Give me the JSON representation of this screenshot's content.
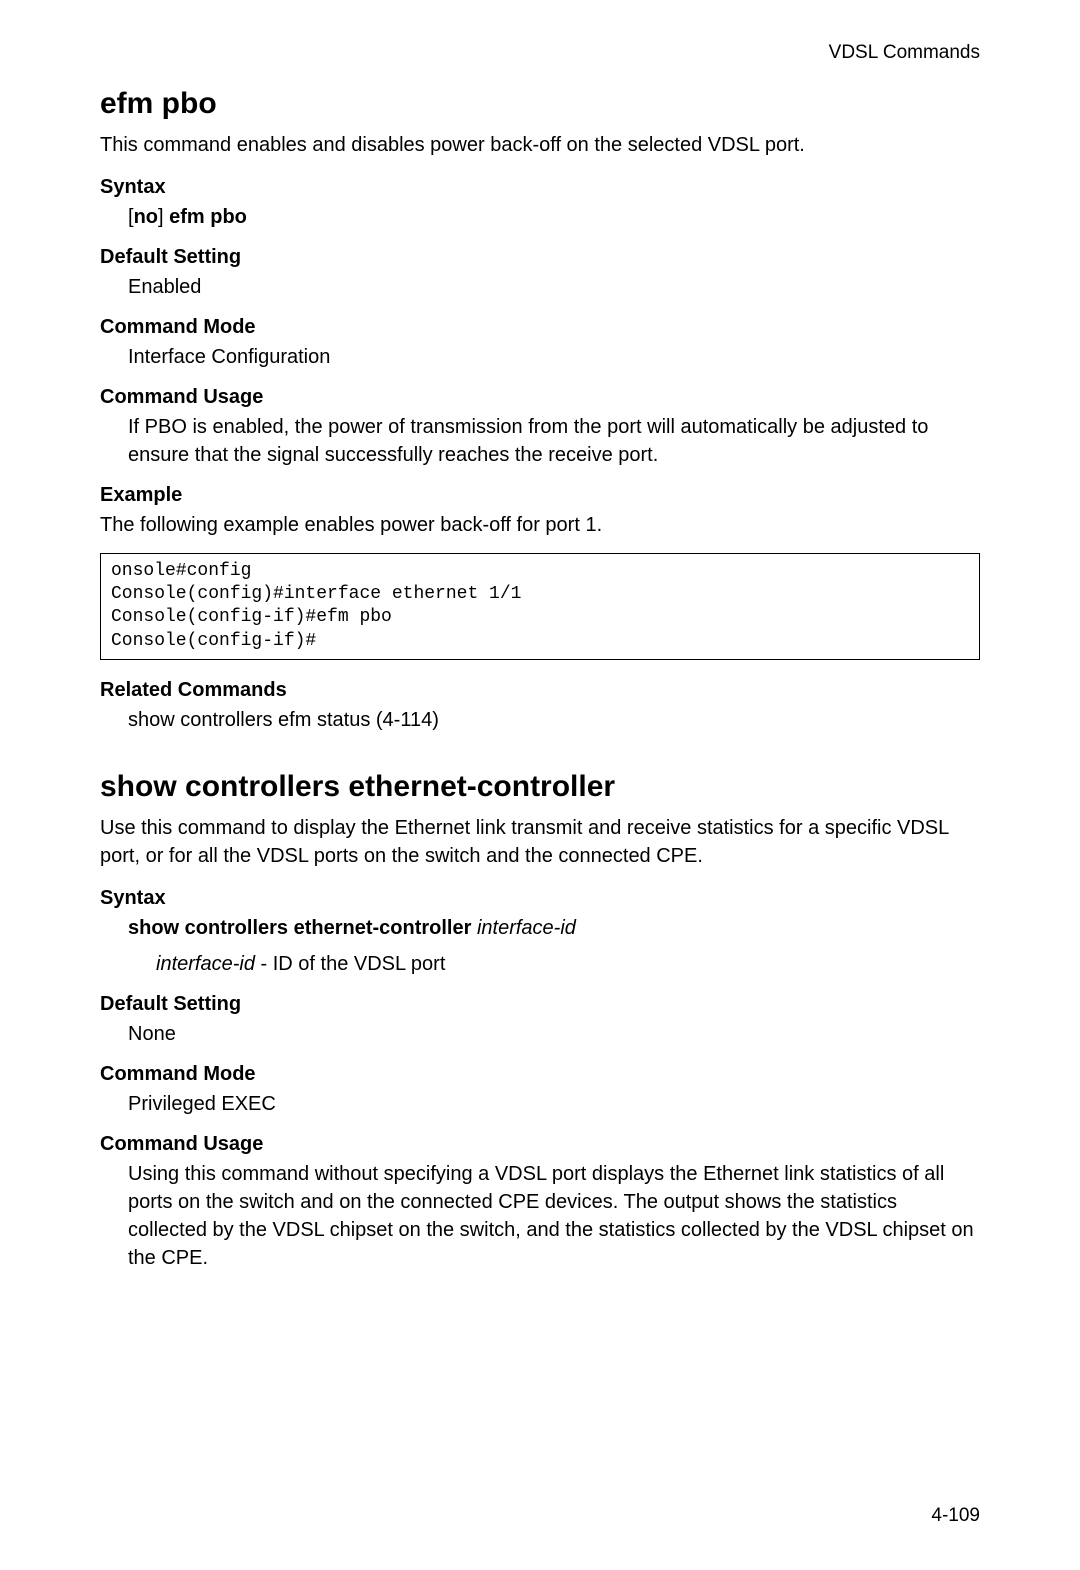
{
  "header": {
    "section_title": "VDSL Commands"
  },
  "cmd1": {
    "title": "efm pbo",
    "description": "This command enables and disables power back-off on the selected VDSL port.",
    "syntax_label": "Syntax",
    "syntax_prefix": "[",
    "syntax_no": "no",
    "syntax_mid": "] ",
    "syntax_cmd": "efm pbo",
    "default_setting_label": "Default Setting",
    "default_setting_value": "Enabled",
    "command_mode_label": "Command Mode",
    "command_mode_value": "Interface Configuration",
    "command_usage_label": "Command Usage",
    "command_usage_text": "If PBO is enabled, the power of transmission from the port will automatically be adjusted to ensure that the signal successfully reaches the receive port.",
    "example_label": "Example",
    "example_intro": "The following example enables power back-off for port 1.",
    "code": "onsole#config\nConsole(config)#interface ethernet 1/1\nConsole(config-if)#efm pbo\nConsole(config-if)#",
    "related_commands_label": "Related Commands",
    "related_commands_value": "show controllers efm status (4-114)"
  },
  "cmd2": {
    "title": "show controllers ethernet-controller",
    "description": "Use this command to display the Ethernet link transmit and receive statistics for a specific VDSL port, or for all the VDSL ports on the switch and the connected CPE.",
    "syntax_label": "Syntax",
    "syntax_cmd": "show controllers ethernet-controller",
    "syntax_space": " ",
    "syntax_arg": "interface-id",
    "arg_name": "interface-id",
    "arg_sep": " - ",
    "arg_desc": "ID of the VDSL port",
    "default_setting_label": "Default Setting",
    "default_setting_value": "None",
    "command_mode_label": "Command Mode",
    "command_mode_value": "Privileged EXEC",
    "command_usage_label": "Command Usage",
    "command_usage_text": "Using this command without specifying a VDSL port displays the Ethernet link statistics of all ports on the switch and on the connected CPE devices. The output shows the statistics collected by the VDSL chipset on the switch, and the statistics collected by the VDSL chipset on the CPE."
  },
  "footer": {
    "page_number": "4-109"
  }
}
